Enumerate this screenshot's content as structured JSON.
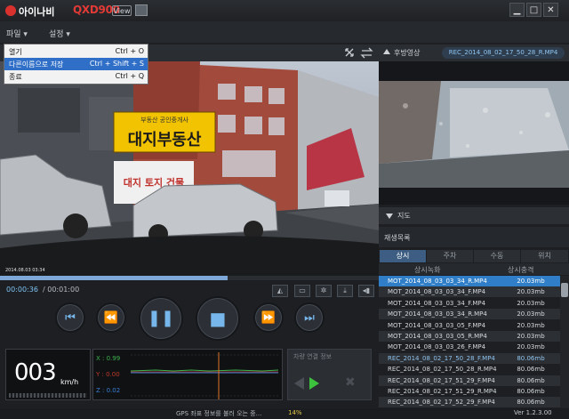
{
  "app": {
    "logo_text": "아이나비",
    "model": "QXD900",
    "view_label": "View"
  },
  "window": {
    "minimize": "▁",
    "maximize": "□",
    "close": "✕"
  },
  "menu": {
    "file": "파일 ▾",
    "settings": "설정 ▾",
    "items": [
      {
        "label": "열기",
        "shortcut": "Ctrl + O"
      },
      {
        "label": "다른이름으로 저장",
        "shortcut": "Ctrl + Shift + S"
      },
      {
        "label": "종료",
        "shortcut": "Ctrl + Q"
      }
    ],
    "selected_index": 1
  },
  "video": {
    "sign_main": "대지부동산",
    "sign_top": "부동산 공인중개사",
    "sign_side": "대지  토지  건물",
    "overlay_text": "2014.08.03 03:34"
  },
  "rear": {
    "label": "후방영상",
    "file": "REC_2014_08_02_17_50_28_R.MP4"
  },
  "map": {
    "label": "지도"
  },
  "playlist": {
    "title": "재생목록",
    "tabs": [
      {
        "label": "상시",
        "active": true
      },
      {
        "label": "주차",
        "active": false
      },
      {
        "label": "수동",
        "active": false
      },
      {
        "label": "위치",
        "active": false
      }
    ],
    "col_file": "상시녹화",
    "col_size": "상시충격",
    "rows": [
      {
        "file": "MOT_2014_08_03_03_34_R.MP4",
        "size": "20.03mb",
        "highlight": true
      },
      {
        "file": "MOT_2014_08_03_03_34_F.MP4",
        "size": "20.03mb"
      },
      {
        "file": "MOT_2014_08_03_03_34_F.MP4",
        "size": "20.03mb"
      },
      {
        "file": "MOT_2014_08_03_03_34_R.MP4",
        "size": "20.03mb"
      },
      {
        "file": "MOT_2014_08_03_03_05_F.MP4",
        "size": "20.03mb"
      },
      {
        "file": "MOT_2014_08_03_03_05_R.MP4",
        "size": "20.03mb"
      },
      {
        "file": "MOT_2014_08_03_03_26_F.MP4",
        "size": "20.03mb"
      },
      {
        "file": "REC_2014_08_02_17_50_28_F.MP4",
        "size": "80.06mb",
        "event": true
      },
      {
        "file": "REC_2014_08_02_17_50_28_R.MP4",
        "size": "80.06mb"
      },
      {
        "file": "REC_2014_08_02_17_51_29_F.MP4",
        "size": "80.06mb"
      },
      {
        "file": "REC_2014_08_02_17_51_29_R.MP4",
        "size": "80.06mb"
      },
      {
        "file": "REC_2014_08_02_17_52_29_F.MP4",
        "size": "80.06mb"
      }
    ]
  },
  "playback": {
    "current_time": "00:00:36",
    "total_time": "/ 00:01:00",
    "progress_fraction": 0.6
  },
  "gsensor": {
    "x_label": "X : 0.99",
    "y_label": "Y : 0.00",
    "z_label": "Z : 0.02",
    "colors": {
      "x": "#3fb34f",
      "y": "#c0392b",
      "z": "#3b7fd4"
    }
  },
  "speed": {
    "value": "003",
    "unit": "km/h"
  },
  "car": {
    "title": "차량 연결 정보"
  },
  "status": {
    "text": "GPS 좌표 정보를 불러 오는 중...",
    "percent": "14%",
    "version": "Ver 1.2.3.00"
  }
}
